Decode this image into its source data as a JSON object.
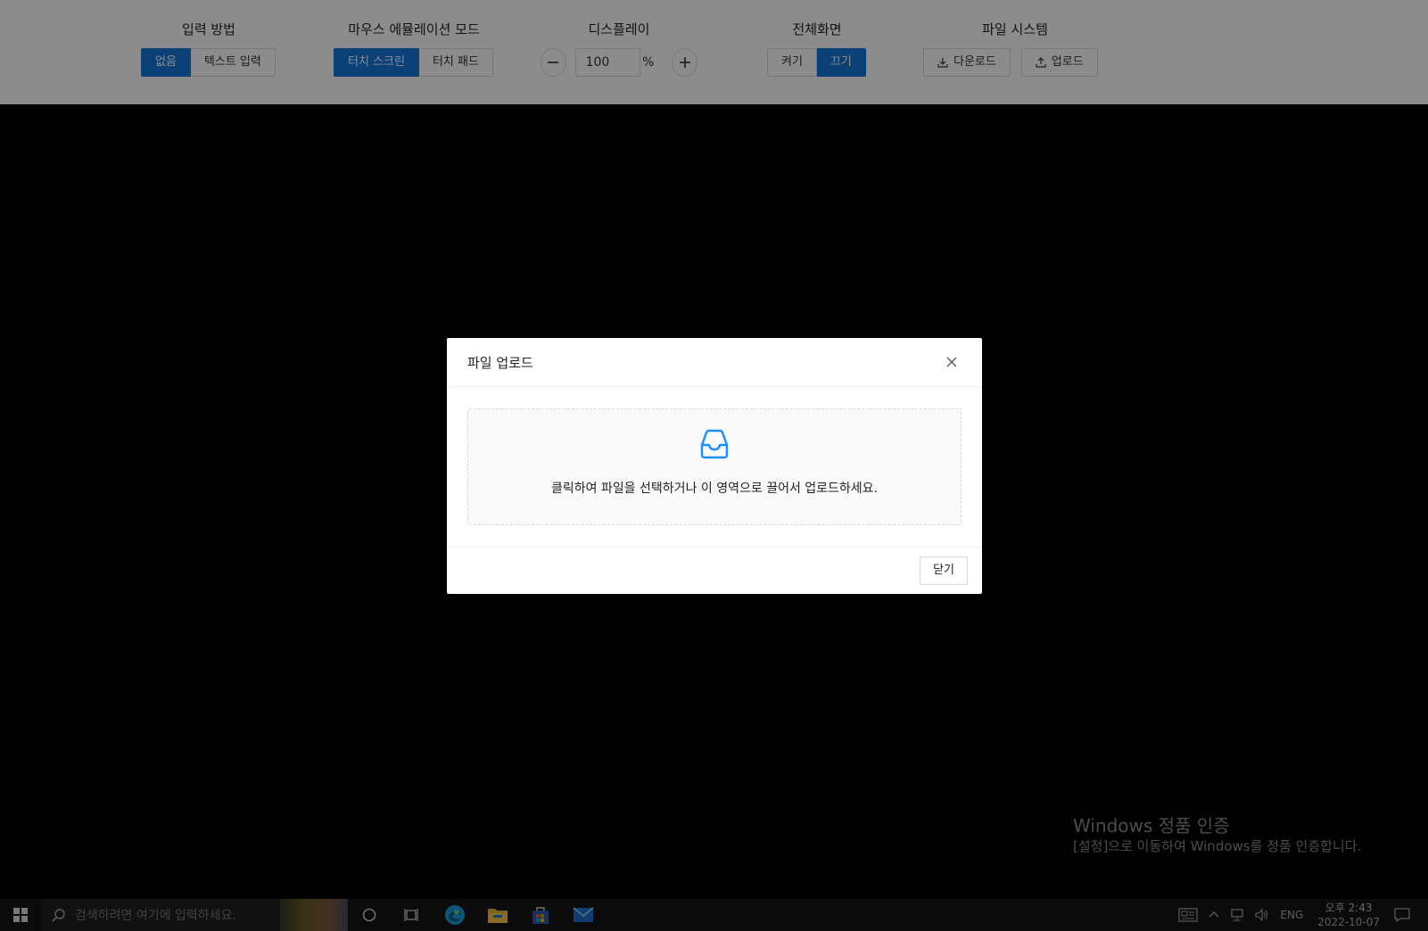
{
  "toolbar": {
    "input_method": {
      "title": "입력 방법",
      "options": [
        "없음",
        "텍스트 입력"
      ]
    },
    "mouse_emulation": {
      "title": "마우스 에뮬레이션 모드",
      "options": [
        "터치 스크린",
        "터치 패드"
      ]
    },
    "display": {
      "title": "디스플레이",
      "minus": "−",
      "value": "100",
      "unit": "%",
      "plus": "+"
    },
    "fullscreen": {
      "title": "전체화면",
      "options": [
        "켜기",
        "끄기"
      ]
    },
    "file_system": {
      "title": "파일 시스템",
      "download_label": "다운로드",
      "upload_label": "업로드"
    }
  },
  "modal": {
    "title": "파일 업로드",
    "dropzone_text": "클릭하여 파일을 선택하거나 이 영역으로 끌어서 업로드하세요.",
    "close_label": "닫기"
  },
  "watermark": {
    "line1": "Windows 정품 인증",
    "line2": "[설정]으로 이동하여 Windows를 정품 인증합니다."
  },
  "taskbar": {
    "search_placeholder": "검색하려면 여기에 입력하세요.",
    "language": "ENG",
    "time": "오후 2:43",
    "date": "2022-10-07"
  },
  "colors": {
    "accent": "#1677d9",
    "upload_icon": "#1890ff"
  }
}
